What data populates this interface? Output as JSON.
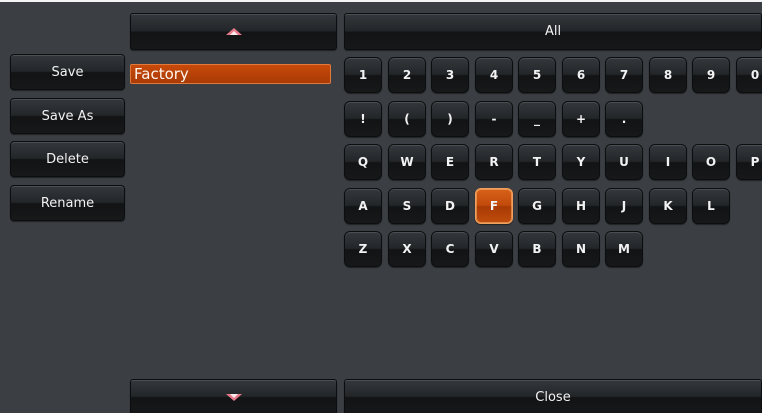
{
  "nav": {
    "up_icon": "chevron-up-icon",
    "down_icon": "chevron-down-icon"
  },
  "filter": {
    "label": "All"
  },
  "actions": {
    "save": "Save",
    "save_as": "Save As",
    "delete": "Delete",
    "rename": "Rename"
  },
  "list": {
    "items": [
      "Factory"
    ],
    "selected_index": 0
  },
  "keyboard": {
    "rows": [
      [
        "1",
        "2",
        "3",
        "4",
        "5",
        "6",
        "7",
        "8",
        "9",
        "0"
      ],
      [
        "!",
        "(",
        ")",
        "-",
        "_",
        "+",
        "."
      ],
      [
        "Q",
        "W",
        "E",
        "R",
        "T",
        "Y",
        "U",
        "I",
        "O",
        "P"
      ],
      [
        "A",
        "S",
        "D",
        "F",
        "G",
        "H",
        "J",
        "K",
        "L"
      ],
      [
        "Z",
        "X",
        "C",
        "V",
        "B",
        "N",
        "M"
      ]
    ],
    "active_key": "F"
  },
  "footer": {
    "close": "Close"
  },
  "colors": {
    "background": "#3b3f43",
    "button": "#1d2023",
    "accent": "#c24a0a",
    "arrow": "#e57a8a"
  }
}
